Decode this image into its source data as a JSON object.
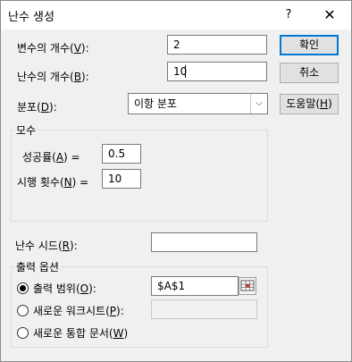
{
  "dialog": {
    "title": "난수 생성",
    "help_label": "?",
    "close_label": "✕"
  },
  "fields": {
    "num_variables": {
      "label": "변수의 개수(",
      "hotkey": "V",
      "label_end": "):",
      "value": "2"
    },
    "num_random": {
      "label": "난수의 개수(",
      "hotkey": "B",
      "label_end": "):",
      "value": "10"
    },
    "distribution": {
      "label": "분포(",
      "hotkey": "D",
      "label_end": "):",
      "value": "이항 분포",
      "arrow": "⌵"
    }
  },
  "buttons": {
    "ok": "확인",
    "cancel": "취소",
    "help": {
      "label": "도움말(",
      "hotkey": "H",
      "label_end": ")"
    }
  },
  "parameters": {
    "title": "모수",
    "success_prob": {
      "label": "성공률(",
      "hotkey": "A",
      "label_end": ") =",
      "value": "0.5"
    },
    "trials": {
      "label": "시행 횟수(",
      "hotkey": "N",
      "label_end": ") =",
      "value": "10"
    }
  },
  "seed": {
    "label": "난수 시드(",
    "hotkey": "R",
    "label_end": "):",
    "value": ""
  },
  "output": {
    "title": "출력 옵션",
    "range": {
      "label": "출력 범위(",
      "hotkey": "O",
      "label_end": "):",
      "value": "$A$1",
      "checked": true
    },
    "new_sheet": {
      "label": "새로운 워크시트(",
      "hotkey": "P",
      "label_end": "):",
      "value": "",
      "checked": false
    },
    "new_workbook": {
      "label": "새로운 통합 문서(",
      "hotkey": "W",
      "label_end": ")",
      "checked": false
    }
  },
  "icons": {
    "ref": "range-select-icon",
    "close": "close-icon",
    "dropdown": "chevron-down-icon"
  }
}
